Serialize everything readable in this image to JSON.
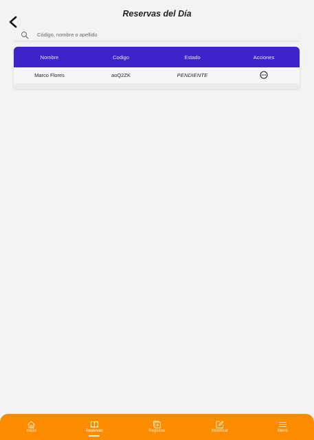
{
  "header": {
    "title": "Reservas del Día"
  },
  "search": {
    "placeholder": "Código, nombre o apellido",
    "value": ""
  },
  "table": {
    "columns": [
      "Nombre",
      "Codigo",
      "Estado",
      "Acciones"
    ],
    "rows": [
      {
        "nombre": "Marco Flores",
        "codigo": "aoQ2ZK",
        "estado": "PENDIENTE",
        "acciones_icon": "more-horizontal-icon"
      }
    ]
  },
  "bottom_nav": {
    "items": [
      {
        "label": "Inicio",
        "icon": "home-icon",
        "active": false
      },
      {
        "label": "Reservas",
        "icon": "book-open-icon",
        "active": true
      },
      {
        "label": "Registrar",
        "icon": "add-box-icon",
        "active": false
      },
      {
        "label": "Modificar",
        "icon": "edit-icon",
        "active": false
      },
      {
        "label": "Menú",
        "icon": "menu-icon",
        "active": false
      }
    ]
  },
  "colors": {
    "table_header": "#3f22c9",
    "bottom_nav": "#fb8c00",
    "background": "#f3f3f3"
  }
}
